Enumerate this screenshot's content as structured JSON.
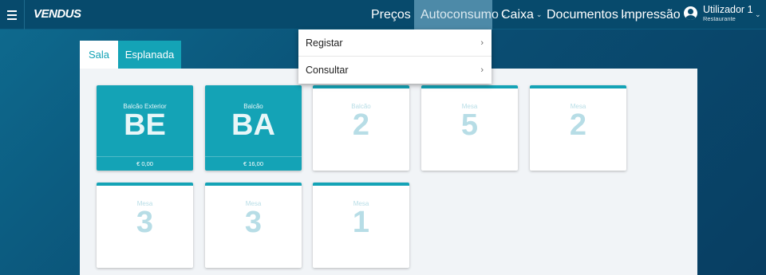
{
  "app": {
    "logo": "VENDUS"
  },
  "nav": {
    "items": [
      {
        "label": "Preços",
        "chevron": "⌄"
      },
      {
        "label": "Autoconsumo",
        "chevron": "⌄"
      },
      {
        "label": "Caixa",
        "chevron": "⌄"
      },
      {
        "label": "Documentos",
        "chevron": "⌄"
      },
      {
        "label": "Impressão",
        "chevron": "⌄"
      }
    ],
    "user": {
      "name": "Utilizador 1",
      "role": "Restaurante",
      "chevron": "⌄"
    }
  },
  "dropdown": {
    "items": [
      {
        "label": "Registar",
        "chevron": "›"
      },
      {
        "label": "Consultar",
        "chevron": "›"
      }
    ]
  },
  "tabs": [
    {
      "label": "Sala",
      "active": true
    },
    {
      "label": "Esplanada",
      "active": false
    }
  ],
  "tables": [
    {
      "label": "Balcão Exterior",
      "code": "BE",
      "amount": "€ 0,00",
      "occupied": true
    },
    {
      "label": "Balcão",
      "code": "BA",
      "amount": "€ 16,00",
      "occupied": true
    },
    {
      "label": "Balcão",
      "code": "2",
      "occupied": false
    },
    {
      "label": "Mesa",
      "code": "5",
      "occupied": false
    },
    {
      "label": "Mesa",
      "code": "2",
      "occupied": false
    },
    {
      "label": "Mesa",
      "code": "3",
      "occupied": false
    },
    {
      "label": "Mesa",
      "code": "3",
      "occupied": false
    },
    {
      "label": "Mesa",
      "code": "1",
      "occupied": false
    }
  ],
  "colors": {
    "accent": "#14a3b6",
    "nav_bg": "#074a6c",
    "nav_active": "#4d8aa8"
  }
}
